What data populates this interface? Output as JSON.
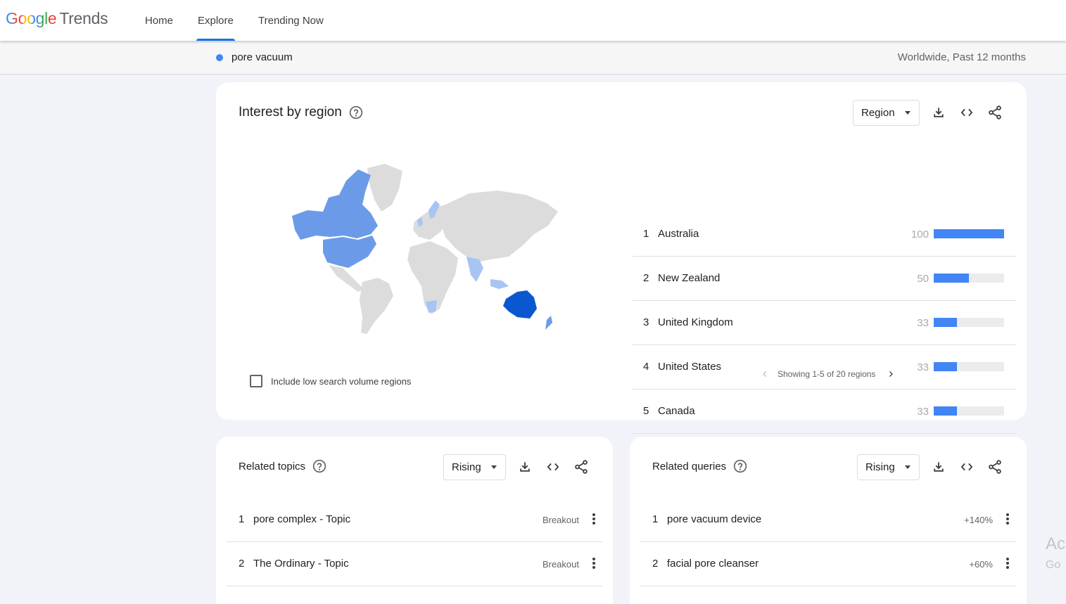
{
  "header": {
    "logo_google": "Google",
    "logo_trends": "Trends",
    "nav": {
      "home": "Home",
      "explore": "Explore",
      "trending": "Trending Now"
    }
  },
  "subheader": {
    "term": "pore vacuum",
    "scope": "Worldwide, Past 12 months"
  },
  "region": {
    "title": "Interest by region",
    "dropdown": "Region",
    "rows": [
      {
        "rank": "1",
        "name": "Australia",
        "value": "100",
        "level": 100
      },
      {
        "rank": "2",
        "name": "New Zealand",
        "value": "50",
        "level": 50
      },
      {
        "rank": "3",
        "name": "United Kingdom",
        "value": "33",
        "level": 33
      },
      {
        "rank": "4",
        "name": "United States",
        "value": "33",
        "level": 33
      },
      {
        "rank": "5",
        "name": "Canada",
        "value": "33",
        "level": 33
      }
    ],
    "pager": "Showing 1-5 of 20 regions",
    "checkbox_label": "Include low search volume regions"
  },
  "topics": {
    "title": "Related topics",
    "dropdown": "Rising",
    "rows": [
      {
        "rank": "1",
        "name": "pore complex - Topic",
        "value": "Breakout"
      },
      {
        "rank": "2",
        "name": "The Ordinary - Topic",
        "value": "Breakout"
      }
    ]
  },
  "queries": {
    "title": "Related queries",
    "dropdown": "Rising",
    "rows": [
      {
        "rank": "1",
        "name": "pore vacuum device",
        "value": "+140%"
      },
      {
        "rank": "2",
        "name": "facial pore cleanser",
        "value": "+60%"
      }
    ]
  },
  "watermark": {
    "line1": "Ac",
    "line2": "Go"
  },
  "colors": {
    "accent": "#1a73e8",
    "bar": "#4285f4",
    "map_high": "#0b57d0",
    "map_mid": "#6b9be8",
    "map_low": "#a8c4f3",
    "map_none": "#dcdcdc"
  }
}
